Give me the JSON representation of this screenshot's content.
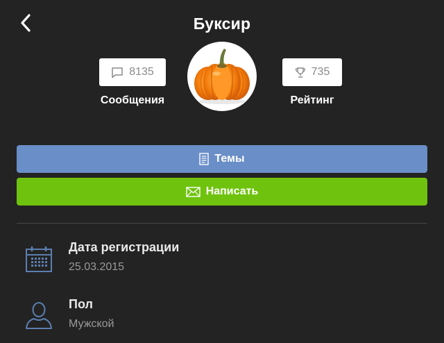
{
  "header": {
    "title": "Буксир",
    "back_icon": "chevron-left-icon"
  },
  "stats": {
    "messages": {
      "icon": "speech-bubble-icon",
      "value": "8135",
      "label": "Сообщения"
    },
    "rating": {
      "icon": "trophy-icon",
      "value": "735",
      "label": "Рейтинг"
    }
  },
  "avatar": {
    "description_icon": "pumpkin-avatar"
  },
  "buttons": {
    "topics": {
      "icon": "document-icon",
      "label": "Темы",
      "color": "#6a8ec7"
    },
    "write": {
      "icon": "envelope-icon",
      "label": "Написать",
      "color": "#6fc30f"
    }
  },
  "info": {
    "registration": {
      "icon": "calendar-icon",
      "label": "Дата регистрации",
      "value": "25.03.2015"
    },
    "gender": {
      "icon": "user-icon",
      "label": "Пол",
      "value": "Мужской"
    }
  },
  "colors": {
    "background": "#232323",
    "icon_blue": "#5b7fb0"
  }
}
